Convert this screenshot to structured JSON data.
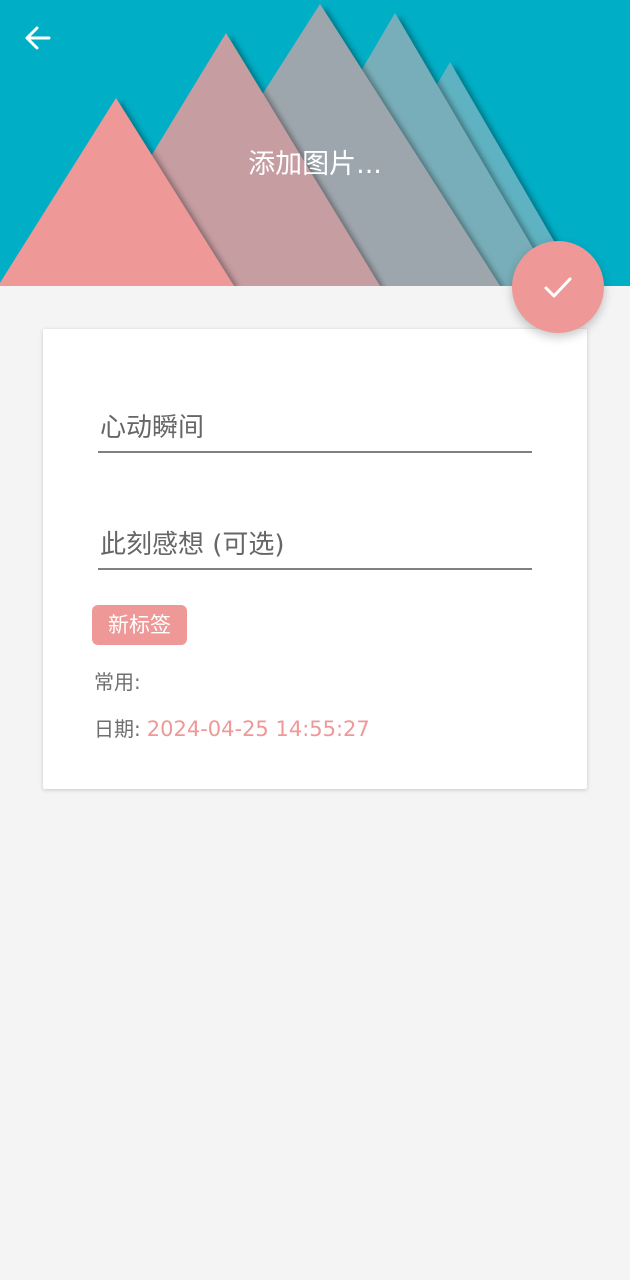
{
  "header": {
    "background_color": "#00aec6",
    "add_image_label": "添加图片...",
    "back_icon": "arrow-left-icon"
  },
  "fab": {
    "icon": "check-icon",
    "color": "#ef9898"
  },
  "form": {
    "title_placeholder": "心动瞬间",
    "note_placeholder": "此刻感想 (可选)",
    "new_tag_label": "新标签",
    "common_label": "常用:",
    "date_label": "日期:",
    "date_value": "2024-04-25  14:55:27"
  },
  "colors": {
    "accent": "#ef9898",
    "page_background": "#f4f4f4",
    "card_background": "#ffffff"
  }
}
